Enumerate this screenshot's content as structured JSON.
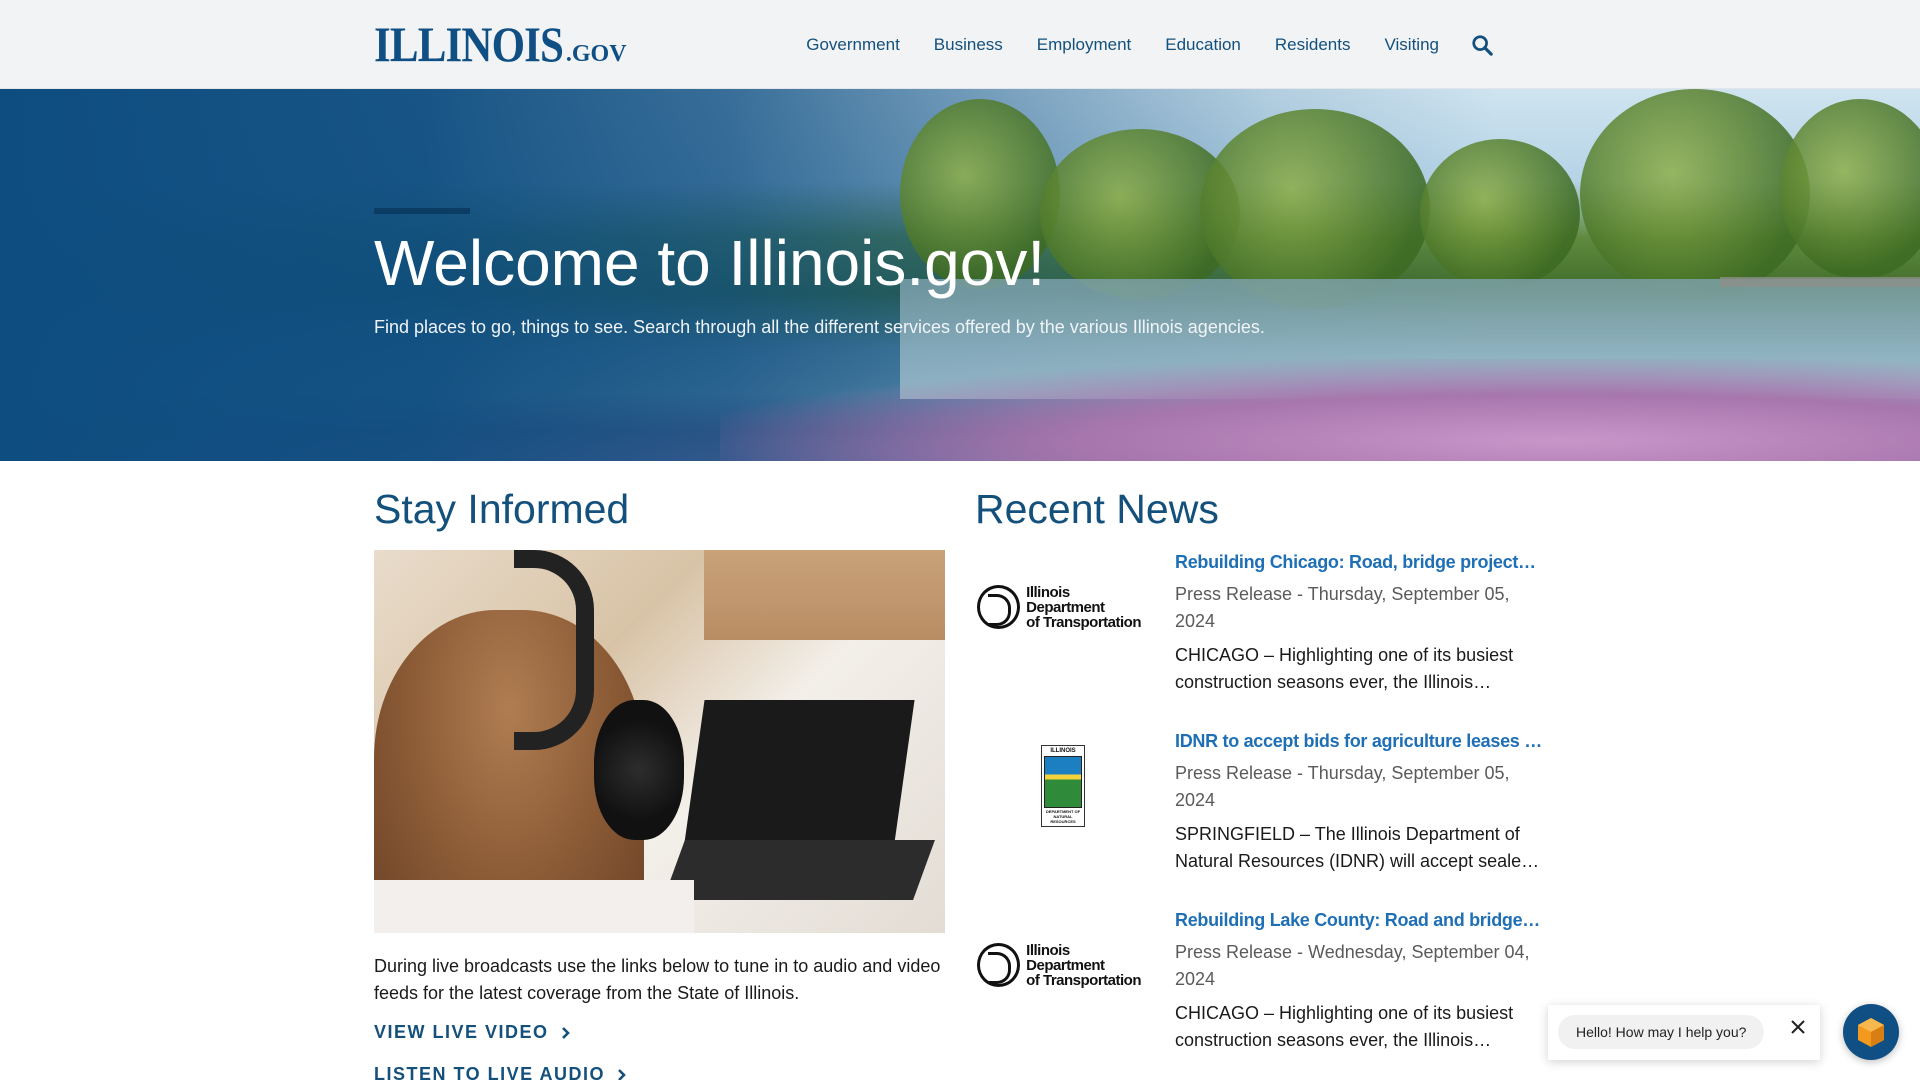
{
  "header": {
    "logo_main": "ILLINOIS",
    "logo_suffix": ".GOV",
    "nav": [
      {
        "label": "Government"
      },
      {
        "label": "Business"
      },
      {
        "label": "Employment"
      },
      {
        "label": "Education"
      },
      {
        "label": "Residents"
      },
      {
        "label": "Visiting"
      }
    ],
    "search_icon": "search-icon"
  },
  "hero": {
    "title": "Welcome to Illinois.gov!",
    "subtitle": "Find places to go, things to see. Search through all the different services offered by the various Illinois agencies."
  },
  "stay_informed": {
    "title": "Stay Informed",
    "description": "During live broadcasts use the links below to tune in to audio and video feeds for the latest coverage from the State of Illinois.",
    "video_link": "VIEW LIVE VIDEO",
    "audio_link": "LISTEN TO LIVE AUDIO"
  },
  "recent_news": {
    "title": "Recent News",
    "items": [
      {
        "logo": "idot-logo",
        "logo_text_1": "Illinois Department",
        "logo_text_2": "of Transportation",
        "title": "Rebuilding Chicago: Road, bridge projects…",
        "meta": "Press Release - Thursday, September 05, 2024",
        "snippet": "CHICAGO – Highlighting one of its busiest construction seasons ever, the Illinois…"
      },
      {
        "logo": "idnr-logo",
        "logo_text_1": "ILLINOIS",
        "logo_text_2": "DEPARTMENT OF NATURAL RESOURCES",
        "title": "IDNR to accept bids for agriculture leases for…",
        "meta": "Press Release - Thursday, September 05, 2024",
        "snippet": "SPRINGFIELD – The Illinois Department of Natural Resources (IDNR) will accept seale…"
      },
      {
        "logo": "idot-logo",
        "logo_text_1": "Illinois Department",
        "logo_text_2": "of Transportation",
        "title": "Rebuilding Lake County: Road and bridge…",
        "meta": "Press Release - Wednesday, September 04, 2024",
        "snippet": "CHICAGO – Highlighting one of its busiest construction seasons ever, the Illinois…"
      }
    ]
  },
  "chat": {
    "greeting": "Hello! How may I help you?"
  },
  "colors": {
    "brand": "#14507c",
    "link": "#1f6fb5",
    "hero_overlay": "#0e4d80"
  }
}
